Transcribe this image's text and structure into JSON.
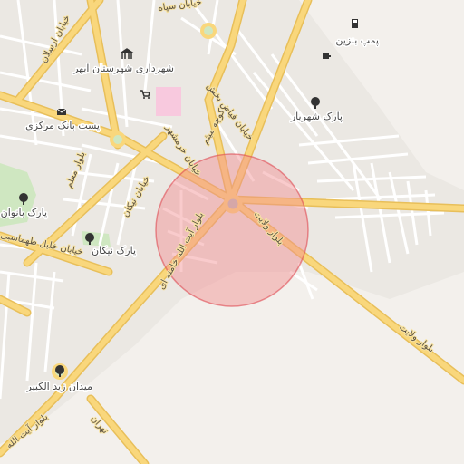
{
  "map": {
    "colors": {
      "background": "#f3f0ec",
      "urban": "#ebe8e3",
      "park": "#cfe7c1",
      "hospital": "#f8c9de",
      "major_road": "#f9d77c",
      "major_road_edge": "#e8bf5a",
      "minor_road": "#ffffff",
      "circle_fill": "#f28b8f",
      "circle_stroke": "#e04a52"
    },
    "labels": {
      "street_arsalan": "خیابان ارسلان",
      "street_sepah": "خیابان سپاه",
      "gas_station": "پمپ بنزین",
      "municipality": "شهرداری شهرستان ابهر",
      "street_fayazbakhsh": "خیابان فیاض بخش",
      "park_shahriar": "پارک شهریار",
      "post_bank": "پست بانک مرکزی",
      "street_khorramshahr": "خیابان خرمشهر",
      "alley_meysam": "کوچه میثم",
      "blvd_moallem": "بلوار معلم",
      "street_nikan": "خیابان نیکان",
      "park_banovan": "پارک بانوان",
      "park_nikan": "پارک نیکان",
      "blvd_khamenei": "بلوار آیت الله خامنه ای",
      "blvd_velayat_1": "بلوار ولایت",
      "blvd_velayat_2": "بلوار ولایت",
      "street_khalil": "خیابان خلیل طهماسبی",
      "square_zeid": "میدان زید الکبیر",
      "blvd_ayatollah_sw": "بلوار آیت الله",
      "street_tehran": "تهران"
    },
    "icons": {
      "gas": "fuel-icon",
      "cafe": "cafe-icon",
      "municipality": "government-icon",
      "shop": "shopping-cart-icon",
      "post": "post-office-icon",
      "park": "tree-icon"
    }
  }
}
